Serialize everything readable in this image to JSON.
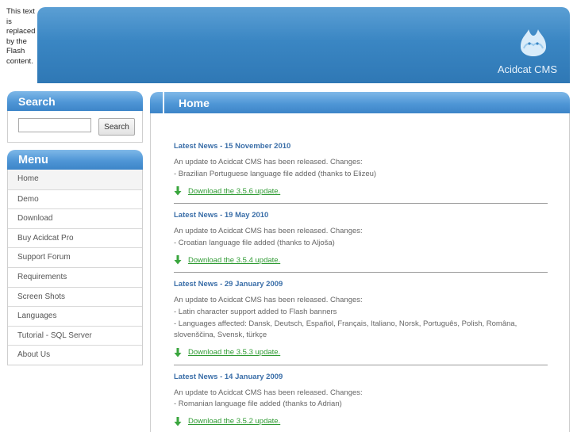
{
  "flash_notice": "This text is replaced by the Flash content.",
  "header": {
    "brand": "Acidcat CMS",
    "logo_icon": "cat-logo-icon"
  },
  "search": {
    "title": "Search",
    "button": "Search",
    "input_value": ""
  },
  "menu": {
    "title": "Menu",
    "items": [
      "Home",
      "Demo",
      "Download",
      "Buy Acidcat Pro",
      "Support Forum",
      "Requirements",
      "Screen Shots",
      "Languages",
      "Tutorial - SQL Server",
      "About Us"
    ]
  },
  "content": {
    "title": "Home",
    "news": [
      {
        "title": "Latest News - 15 November 2010",
        "intro": "An update to Acidcat CMS has been released. Changes:",
        "changes": [
          "- Brazilian Portuguese language file added (thanks to Elizeu)"
        ],
        "link": "Download the 3.5.6 update."
      },
      {
        "title": "Latest News - 19 May 2010",
        "intro": "An update to Acidcat CMS has been released. Changes:",
        "changes": [
          "- Croatian language file added (thanks to Aljoša)"
        ],
        "link": "Download the 3.5.4 update."
      },
      {
        "title": "Latest News - 29 January 2009",
        "intro": "An update to Acidcat CMS has been released. Changes:",
        "changes": [
          "- Latin character support added to Flash banners",
          "- Languages affected: Dansk, Deutsch, Español, Français, Italiano, Norsk, Português, Polish, Româna, slovenščina, Svensk, türkçe"
        ],
        "link": "Download the 3.5.3 update."
      },
      {
        "title": "Latest News - 14 January 2009",
        "intro": "An update to Acidcat CMS has been released. Changes:",
        "changes": [
          "- Romanian language file added (thanks to Adrian)"
        ],
        "link": "Download the 3.5.2 update."
      }
    ]
  },
  "colors": {
    "header_blue": "#3a86c3",
    "news_title": "#3a6ea8",
    "download_link": "#2e9a32"
  }
}
